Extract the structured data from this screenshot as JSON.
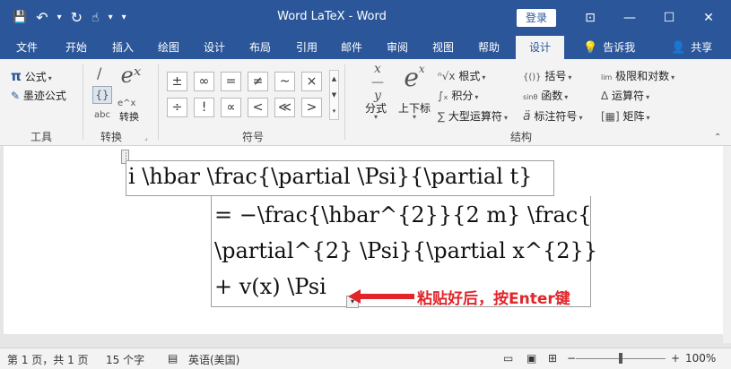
{
  "window": {
    "title": "Word LaTeX - Word",
    "login_label": "登录",
    "buttons": {
      "ribbon_display": "⊡",
      "minimize": "—",
      "maximize": "☐",
      "close": "✕"
    }
  },
  "qat": {
    "save": "💾",
    "undo": "↶",
    "undo_dd": "▾",
    "redo": "↻",
    "touch": "☝",
    "touch_dd": "▾",
    "customize": "▾"
  },
  "tabs": [
    "文件",
    "开始",
    "插入",
    "绘图",
    "设计",
    "布局",
    "引用",
    "邮件",
    "审阅",
    "视图",
    "帮助",
    "设计"
  ],
  "tell_me": "告诉我",
  "share": "共享",
  "ribbon": {
    "tools_group": {
      "label": "工具",
      "formula": "公式",
      "formula_icon": "π",
      "ink_formula": "墨迹公式",
      "ink_icon": "✎"
    },
    "convert_group": {
      "label": "转换",
      "convert": "转换",
      "linear_icon": "/",
      "professional_icon": "{}",
      "text_icon": "abc",
      "convert_icon": "eˣ"
    },
    "symbols_group": {
      "label": "符号",
      "symbols": [
        "±",
        "∞",
        "=",
        "≠",
        "~",
        "×",
        "÷",
        "!",
        "∝",
        "<",
        "≪",
        ">"
      ]
    },
    "structures_group": {
      "label": "结构",
      "fraction": "分式",
      "script": "上下标",
      "radical": "根式",
      "integral": "积分",
      "large_operator": "大型运算符",
      "bracket": "括号",
      "function": "函数",
      "accent": "标注符号",
      "limit_log": "极限和对数",
      "operator": "运算符",
      "matrix": "矩阵"
    }
  },
  "equation": {
    "lines": [
      "i \\hbar \\frac{\\partial \\Psi}{\\partial t}",
      "= −\\frac{\\hbar^{2}}{2 m} \\frac{",
      "\\partial^{2} \\Psi}{\\partial x^{2}}",
      "+ v(x) \\Psi"
    ]
  },
  "annotation": {
    "text": "粘贴好后，按Enter键",
    "color": "#e0262b"
  },
  "statusbar": {
    "page": "第 1 页，共 1 页",
    "words": "15 个字",
    "language": "英语(美国)",
    "zoom_minus": "−",
    "zoom_plus": "+",
    "zoom": "100%"
  },
  "colors": {
    "brand": "#2b579a",
    "annotation": "#e0262b"
  }
}
